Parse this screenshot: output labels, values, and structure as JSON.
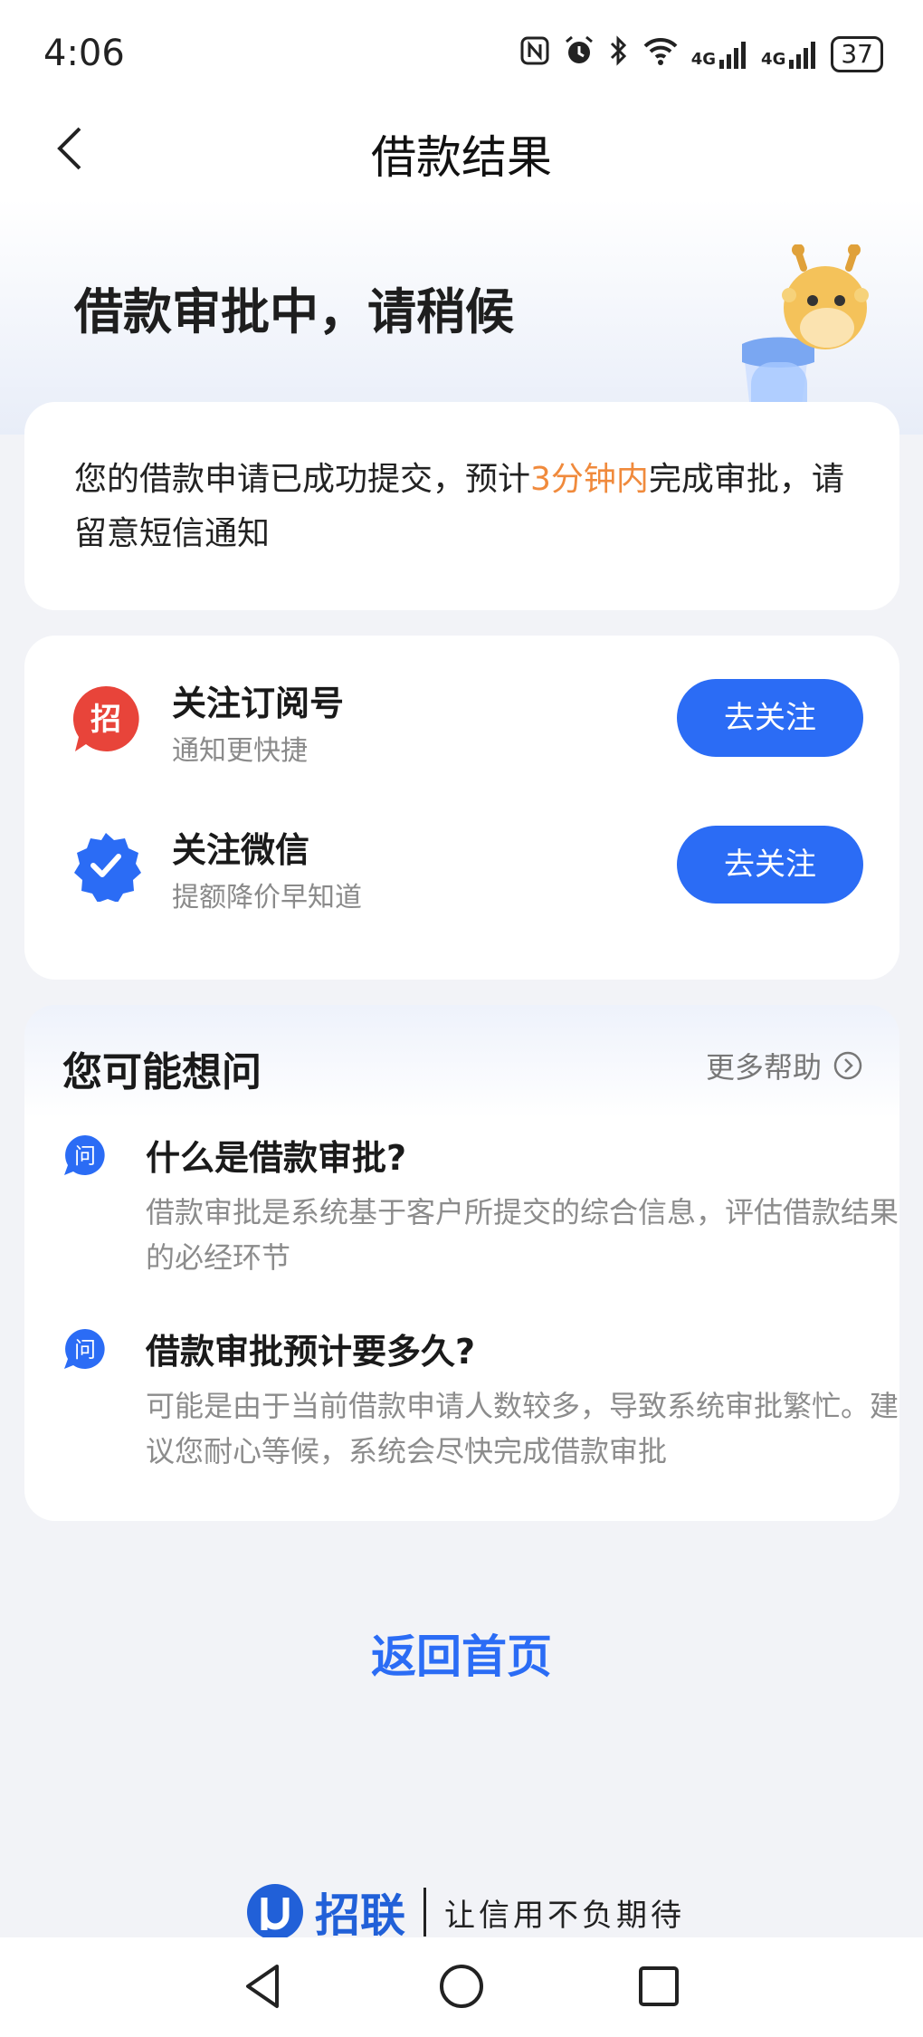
{
  "status_bar": {
    "time": "4:06",
    "signal_1": "4G",
    "signal_2": "4G",
    "battery": "37"
  },
  "header": {
    "title": "借款结果"
  },
  "hero": {
    "title": "借款审批中，请稍候"
  },
  "notice": {
    "text_before": "您的借款申请已成功提交，预计",
    "highlight": "3分钟内",
    "text_after": "完成审批，请留意短信通知",
    "highlight_color": "#f08a3c"
  },
  "follow": {
    "items": [
      {
        "title": "关注订阅号",
        "subtitle": "通知更快捷",
        "button": "去关注",
        "icon_text": "招"
      },
      {
        "title": "关注微信",
        "subtitle": "提额降价早知道",
        "button": "去关注"
      }
    ]
  },
  "faq": {
    "title": "您可能想问",
    "more_help": "更多帮助",
    "icon_text": "问",
    "items": [
      {
        "question": "什么是借款审批?",
        "answer": "借款审批是系统基于客户所提交的综合信息，评估借款结果的必经环节"
      },
      {
        "question": "借款审批预计要多久?",
        "answer": "可能是由于当前借款申请人数较多，导致系统审批繁忙。建议您耐心等候，系统会尽快完成借款审批"
      }
    ]
  },
  "footer": {
    "home_link": "返回首页",
    "brand_name": "招联",
    "slogan": "让信用不负期待"
  },
  "colors": {
    "accent": "#2b6cf5",
    "highlight": "#f08a3c",
    "background": "#f2f3f7"
  }
}
